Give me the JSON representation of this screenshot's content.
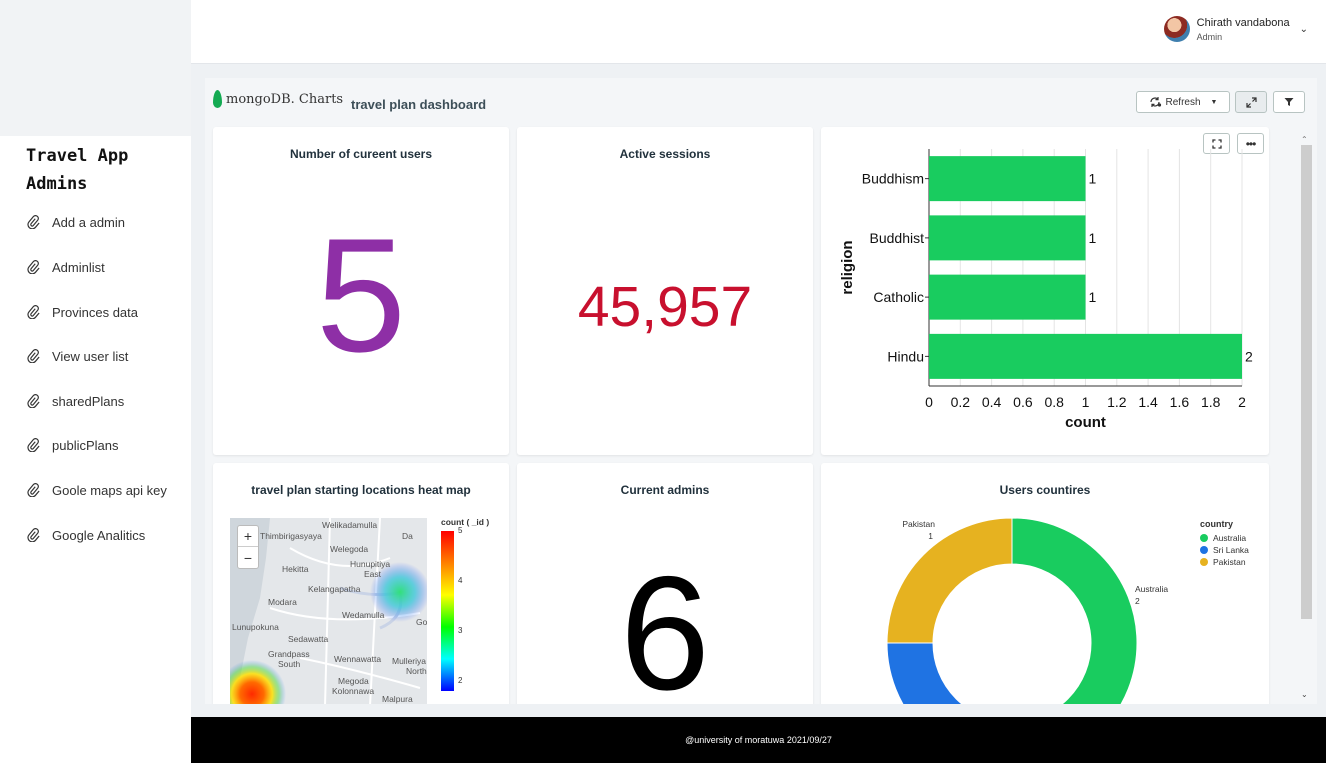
{
  "sidebar": {
    "title": "Travel App Admins",
    "items": [
      {
        "label": "Add a admin"
      },
      {
        "label": "Adminlist"
      },
      {
        "label": "Provinces data"
      },
      {
        "label": "View user list"
      },
      {
        "label": "sharedPlans"
      },
      {
        "label": "publicPlans"
      },
      {
        "label": "Goole maps api key"
      },
      {
        "label": "Google Analitics"
      }
    ]
  },
  "header": {
    "user_name": "Chirath vandabona",
    "user_role": "Admin"
  },
  "dashboard": {
    "brand": "mongoDB. Charts",
    "title": "travel plan dashboard",
    "refresh_label": "Refresh"
  },
  "cards": {
    "current_users": {
      "title": "Number of cureent users",
      "value": "5",
      "color": "#8e2fa6"
    },
    "active_sessions": {
      "title": "Active sessions",
      "value": "45,957",
      "color": "#c8102e"
    },
    "heat_map": {
      "title": "travel plan starting locations heat map",
      "legend_title": "count ( _id )",
      "legend_ticks": [
        "5",
        "4",
        "3",
        "2"
      ],
      "places": [
        "Welikadamulla",
        "Thimbirigasyaya",
        "Welegoda",
        "Hunupitiya",
        "East",
        "Hekitta",
        "Kelangapatha",
        "Modara",
        "Wedamulla",
        "Lunupokuna",
        "Sedawatta",
        "Grandpass",
        "South",
        "Wennawatta",
        "Mulleriya",
        "North",
        "Megoda",
        "Kolonnawa",
        "Malpura",
        "Da",
        "Go"
      ]
    },
    "current_admins": {
      "title": "Current admins",
      "value": "6",
      "color": "#000000"
    },
    "countries": {
      "title": "Users countires",
      "legend_title": "country"
    }
  },
  "footer": {
    "text": "@university of moratuwa 2021/09/27"
  },
  "chart_data": [
    {
      "type": "bar",
      "orientation": "horizontal",
      "title": "",
      "xlabel": "count",
      "ylabel": "religion",
      "categories": [
        "Buddhism",
        "Buddhist",
        "Catholic",
        "Hindu"
      ],
      "values": [
        1,
        1,
        1,
        2
      ],
      "xlim": [
        0,
        2
      ],
      "xticks": [
        "0",
        "0.2",
        "0.4",
        "0.6",
        "0.8",
        "1",
        "1.2",
        "1.4",
        "1.6",
        "1.8",
        "2"
      ],
      "color": "#19cc5f",
      "grid": true
    },
    {
      "type": "pie",
      "style": "donut",
      "title": "Users countires",
      "legend_title": "country",
      "legend_position": "top-right",
      "slices": [
        {
          "label": "Australia",
          "value": 2,
          "color": "#19cc5f"
        },
        {
          "label": "Sri Lanka",
          "value": 1,
          "color": "#1f73e3"
        },
        {
          "label": "Pakistan",
          "value": 1,
          "color": "#e6b220"
        }
      ]
    }
  ]
}
